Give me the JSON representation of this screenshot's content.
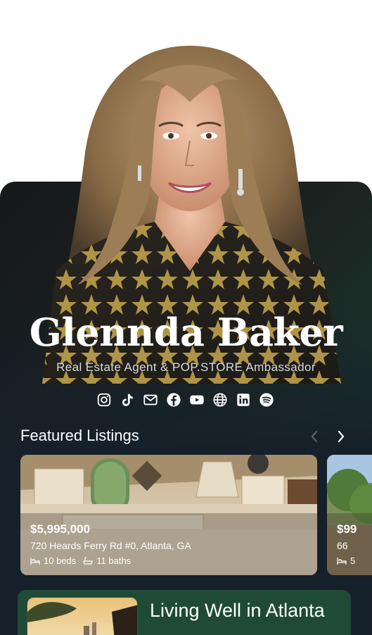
{
  "profile": {
    "name": "Glennda Baker",
    "subtitle": "Real Estate Agent & POP.STORE Ambassador"
  },
  "socials": [
    {
      "icon": "instagram-icon"
    },
    {
      "icon": "tiktok-icon"
    },
    {
      "icon": "email-icon"
    },
    {
      "icon": "facebook-icon"
    },
    {
      "icon": "youtube-icon"
    },
    {
      "icon": "globe-icon"
    },
    {
      "icon": "linkedin-icon"
    },
    {
      "icon": "spotify-icon"
    }
  ],
  "featured": {
    "title": "Featured Listings",
    "listings": [
      {
        "price": "$5,995,000",
        "address": "720 Heards Ferry Rd #0, Atlanta, GA",
        "beds": "10 beds",
        "baths": "11 baths"
      },
      {
        "price": "$99",
        "address": "66",
        "beds": "5"
      }
    ]
  },
  "blog": {
    "title": "Living Well in Atlanta"
  },
  "colors": {
    "accent_green": "#1e4a36",
    "card_dark": "#16202a",
    "text_white": "#ffffff"
  }
}
